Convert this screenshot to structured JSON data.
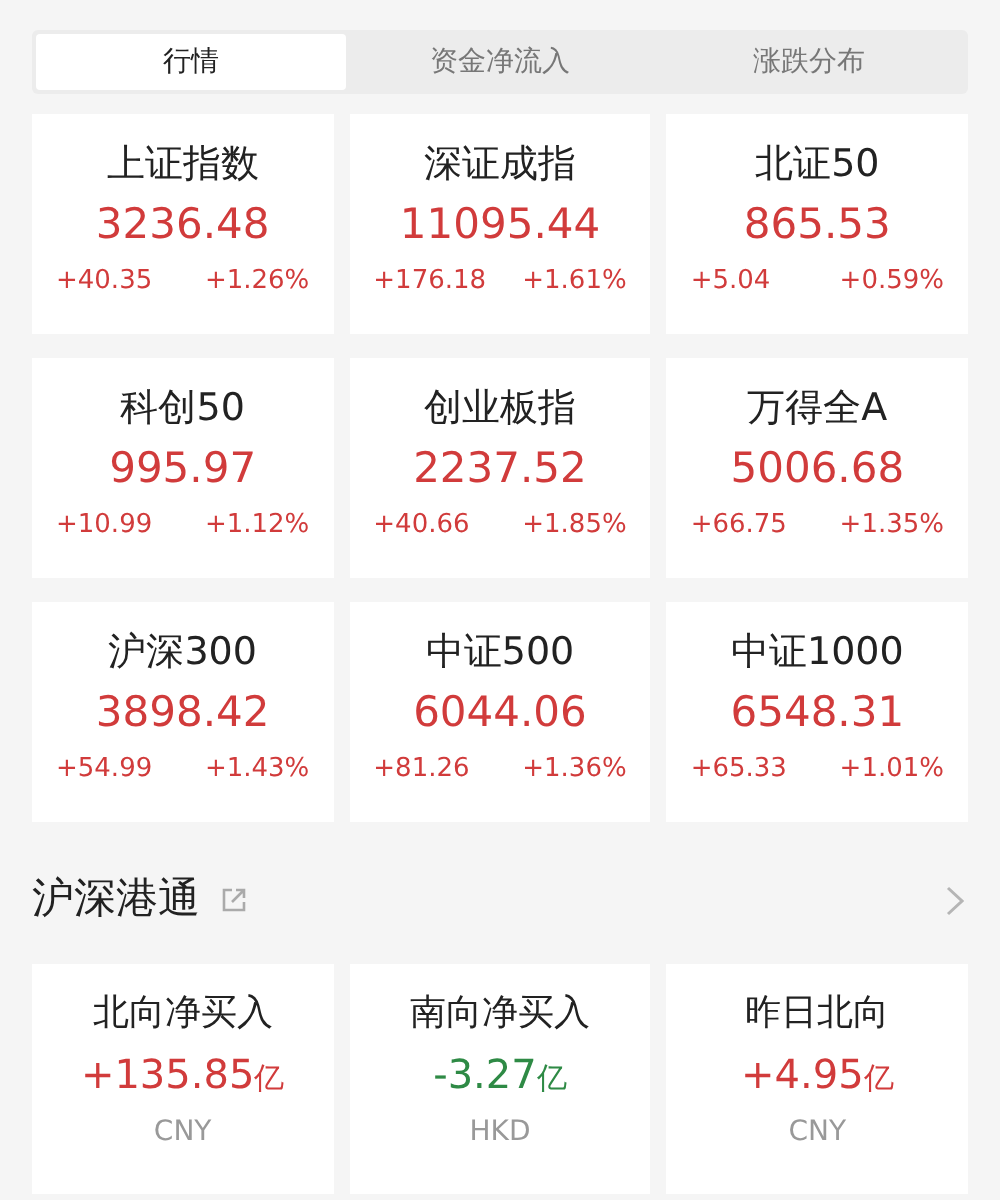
{
  "tabs": [
    {
      "label": "行情",
      "selected": true
    },
    {
      "label": "资金净流入",
      "selected": false
    },
    {
      "label": "涨跌分布",
      "selected": false
    }
  ],
  "indices": [
    {
      "name": "上证指数",
      "value": "3236.48",
      "change": "+40.35",
      "percent": "+1.26%",
      "color": "#d13b3b"
    },
    {
      "name": "深证成指",
      "value": "11095.44",
      "change": "+176.18",
      "percent": "+1.61%",
      "color": "#d13b3b"
    },
    {
      "name": "北证50",
      "value": "865.53",
      "change": "+5.04",
      "percent": "+0.59%",
      "color": "#d13b3b"
    },
    {
      "name": "科创50",
      "value": "995.97",
      "change": "+10.99",
      "percent": "+1.12%",
      "color": "#d13b3b"
    },
    {
      "name": "创业板指",
      "value": "2237.52",
      "change": "+40.66",
      "percent": "+1.85%",
      "color": "#d13b3b"
    },
    {
      "name": "万得全A",
      "value": "5006.68",
      "change": "+66.75",
      "percent": "+1.35%",
      "color": "#d13b3b"
    },
    {
      "name": "沪深300",
      "value": "3898.42",
      "change": "+54.99",
      "percent": "+1.43%",
      "color": "#d13b3b"
    },
    {
      "name": "中证500",
      "value": "6044.06",
      "change": "+81.26",
      "percent": "+1.36%",
      "color": "#d13b3b"
    },
    {
      "name": "中证1000",
      "value": "6548.31",
      "change": "+65.33",
      "percent": "+1.01%",
      "color": "#d13b3b"
    }
  ],
  "connect": {
    "title": "沪深港通",
    "items": [
      {
        "name": "北向净买入",
        "value": "+135.85",
        "unit": "亿",
        "currency": "CNY",
        "color": "#d13b3b"
      },
      {
        "name": "南向净买入",
        "value": "-3.27",
        "unit": "亿",
        "currency": "HKD",
        "color": "#2e8a45"
      },
      {
        "name": "昨日北向",
        "value": "+4.95",
        "unit": "亿",
        "currency": "CNY",
        "color": "#d13b3b"
      }
    ]
  }
}
